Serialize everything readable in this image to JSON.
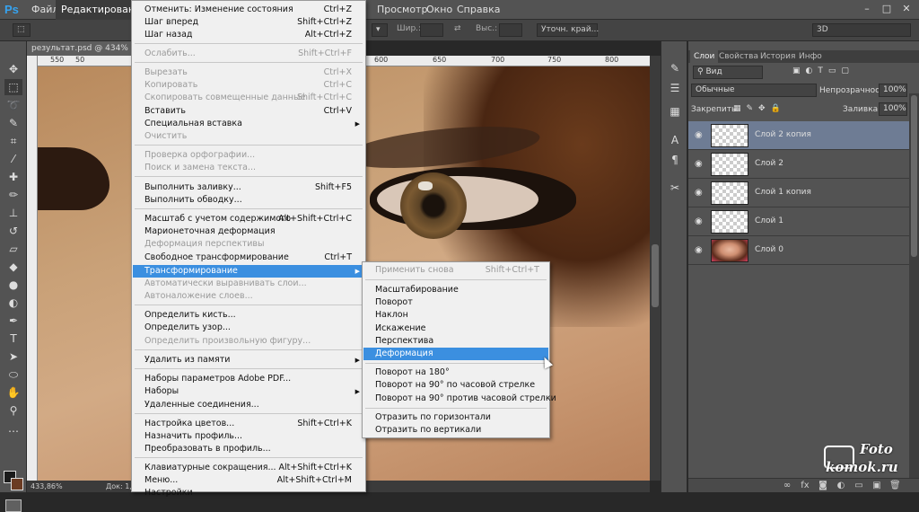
{
  "menubar": {
    "logo": "Ps",
    "items": [
      "Файл",
      "Редактирование",
      "",
      "",
      "",
      "",
      "Просмотр",
      "Окно",
      "Справка"
    ],
    "window_buttons": [
      "–",
      "□",
      "✕"
    ]
  },
  "options_bar": {
    "width_label": "Шир.:",
    "height_label": "Выс.:",
    "refine_button": "Уточн. край...",
    "workspace": "3D"
  },
  "document": {
    "tab_title": "результат.psd @ 434% (Сло",
    "zoom": "433,86%",
    "doc_info": "Док: 1,81"
  },
  "rulers": {
    "top": [
      "550",
      "50",
      "600",
      "650",
      "700",
      "750",
      "800"
    ],
    "left": [
      "3",
      "2",
      "5",
      "0",
      "2",
      "5",
      "5",
      "3",
      "0",
      "0",
      "3",
      "5"
    ]
  },
  "edit_menu": {
    "items": [
      {
        "label": "Отменить: Изменение состояния",
        "shortcut": "Ctrl+Z",
        "disabled": false
      },
      {
        "label": "Шаг вперед",
        "shortcut": "Shift+Ctrl+Z",
        "disabled": false
      },
      {
        "label": "Шаг назад",
        "shortcut": "Alt+Ctrl+Z",
        "disabled": false
      },
      {
        "label": "Ослабить...",
        "shortcut": "Shift+Ctrl+F",
        "disabled": true
      },
      {
        "label": "Вырезать",
        "shortcut": "Ctrl+X",
        "disabled": true
      },
      {
        "label": "Копировать",
        "shortcut": "Ctrl+C",
        "disabled": true
      },
      {
        "label": "Скопировать совмещенные данные",
        "shortcut": "Shift+Ctrl+C",
        "disabled": true
      },
      {
        "label": "Вставить",
        "shortcut": "Ctrl+V",
        "disabled": false
      },
      {
        "label": "Специальная вставка",
        "shortcut": "",
        "disabled": false,
        "submenu": true
      },
      {
        "label": "Очистить",
        "shortcut": "",
        "disabled": true
      },
      {
        "label": "Проверка орфографии...",
        "shortcut": "",
        "disabled": true
      },
      {
        "label": "Поиск и замена текста...",
        "shortcut": "",
        "disabled": true
      },
      {
        "label": "Выполнить заливку...",
        "shortcut": "Shift+F5",
        "disabled": false
      },
      {
        "label": "Выполнить обводку...",
        "shortcut": "",
        "disabled": false
      },
      {
        "label": "Масштаб с учетом содержимого",
        "shortcut": "Alt+Shift+Ctrl+C",
        "disabled": false
      },
      {
        "label": "Марионеточная деформация",
        "shortcut": "",
        "disabled": false
      },
      {
        "label": "Деформация перспективы",
        "shortcut": "",
        "disabled": true
      },
      {
        "label": "Свободное трансформирование",
        "shortcut": "Ctrl+T",
        "disabled": false
      },
      {
        "label": "Трансформирование",
        "shortcut": "",
        "disabled": false,
        "submenu": true,
        "highlighted": true
      },
      {
        "label": "Автоматически выравнивать слои...",
        "shortcut": "",
        "disabled": true
      },
      {
        "label": "Автоналожение слоев...",
        "shortcut": "",
        "disabled": true
      },
      {
        "label": "Определить кисть...",
        "shortcut": "",
        "disabled": false
      },
      {
        "label": "Определить узор...",
        "shortcut": "",
        "disabled": false
      },
      {
        "label": "Определить произвольную фигуру...",
        "shortcut": "",
        "disabled": true
      },
      {
        "label": "Удалить из памяти",
        "shortcut": "",
        "disabled": false,
        "submenu": true
      },
      {
        "label": "Наборы параметров Adobe PDF...",
        "shortcut": "",
        "disabled": false
      },
      {
        "label": "Наборы",
        "shortcut": "",
        "disabled": false,
        "submenu": true
      },
      {
        "label": "Удаленные соединения...",
        "shortcut": "",
        "disabled": false
      },
      {
        "label": "Настройка цветов...",
        "shortcut": "Shift+Ctrl+K",
        "disabled": false
      },
      {
        "label": "Назначить профиль...",
        "shortcut": "",
        "disabled": false
      },
      {
        "label": "Преобразовать в профиль...",
        "shortcut": "",
        "disabled": false
      },
      {
        "label": "Клавиатурные сокращения...",
        "shortcut": "Alt+Shift+Ctrl+K",
        "disabled": false
      },
      {
        "label": "Меню...",
        "shortcut": "Alt+Shift+Ctrl+M",
        "disabled": false
      },
      {
        "label": "Настройки",
        "shortcut": "",
        "disabled": false
      }
    ]
  },
  "transform_submenu": {
    "items": [
      {
        "label": "Применить снова",
        "shortcut": "Shift+Ctrl+T",
        "disabled": true
      },
      {
        "label": "Масштабирование",
        "shortcut": "",
        "disabled": false
      },
      {
        "label": "Поворот",
        "shortcut": "",
        "disabled": false
      },
      {
        "label": "Наклон",
        "shortcut": "",
        "disabled": false
      },
      {
        "label": "Искажение",
        "shortcut": "",
        "disabled": false
      },
      {
        "label": "Перспектива",
        "shortcut": "",
        "disabled": false
      },
      {
        "label": "Деформация",
        "shortcut": "",
        "disabled": false,
        "highlighted": true
      },
      {
        "label": "Поворот на 180°",
        "shortcut": "",
        "disabled": false
      },
      {
        "label": "Поворот на 90° по часовой стрелке",
        "shortcut": "",
        "disabled": false
      },
      {
        "label": "Поворот на 90° против часовой стрелки",
        "shortcut": "",
        "disabled": false
      },
      {
        "label": "Отразить по горизонтали",
        "shortcut": "",
        "disabled": false
      },
      {
        "label": "Отразить по вертикали",
        "shortcut": "",
        "disabled": false
      }
    ]
  },
  "layers_panel": {
    "tabs": [
      "Слои",
      "Свойства",
      "История",
      "Инфо"
    ],
    "filter": "Вид",
    "blend_mode": "Обычные",
    "opacity_label": "Непрозрачность:",
    "opacity": "100%",
    "lock_label": "Закрепить:",
    "fill_label": "Заливка:",
    "fill": "100%",
    "layers": [
      {
        "name": "Слой 2 копия",
        "selected": true,
        "photo": false
      },
      {
        "name": "Слой 2",
        "selected": false,
        "photo": false
      },
      {
        "name": "Слой 1 копия",
        "selected": false,
        "photo": false
      },
      {
        "name": "Слой 1",
        "selected": false,
        "photo": false
      },
      {
        "name": "Слой 0",
        "selected": false,
        "photo": true
      }
    ]
  },
  "watermark": {
    "top": "Foto",
    "bottom": "komok.ru"
  }
}
